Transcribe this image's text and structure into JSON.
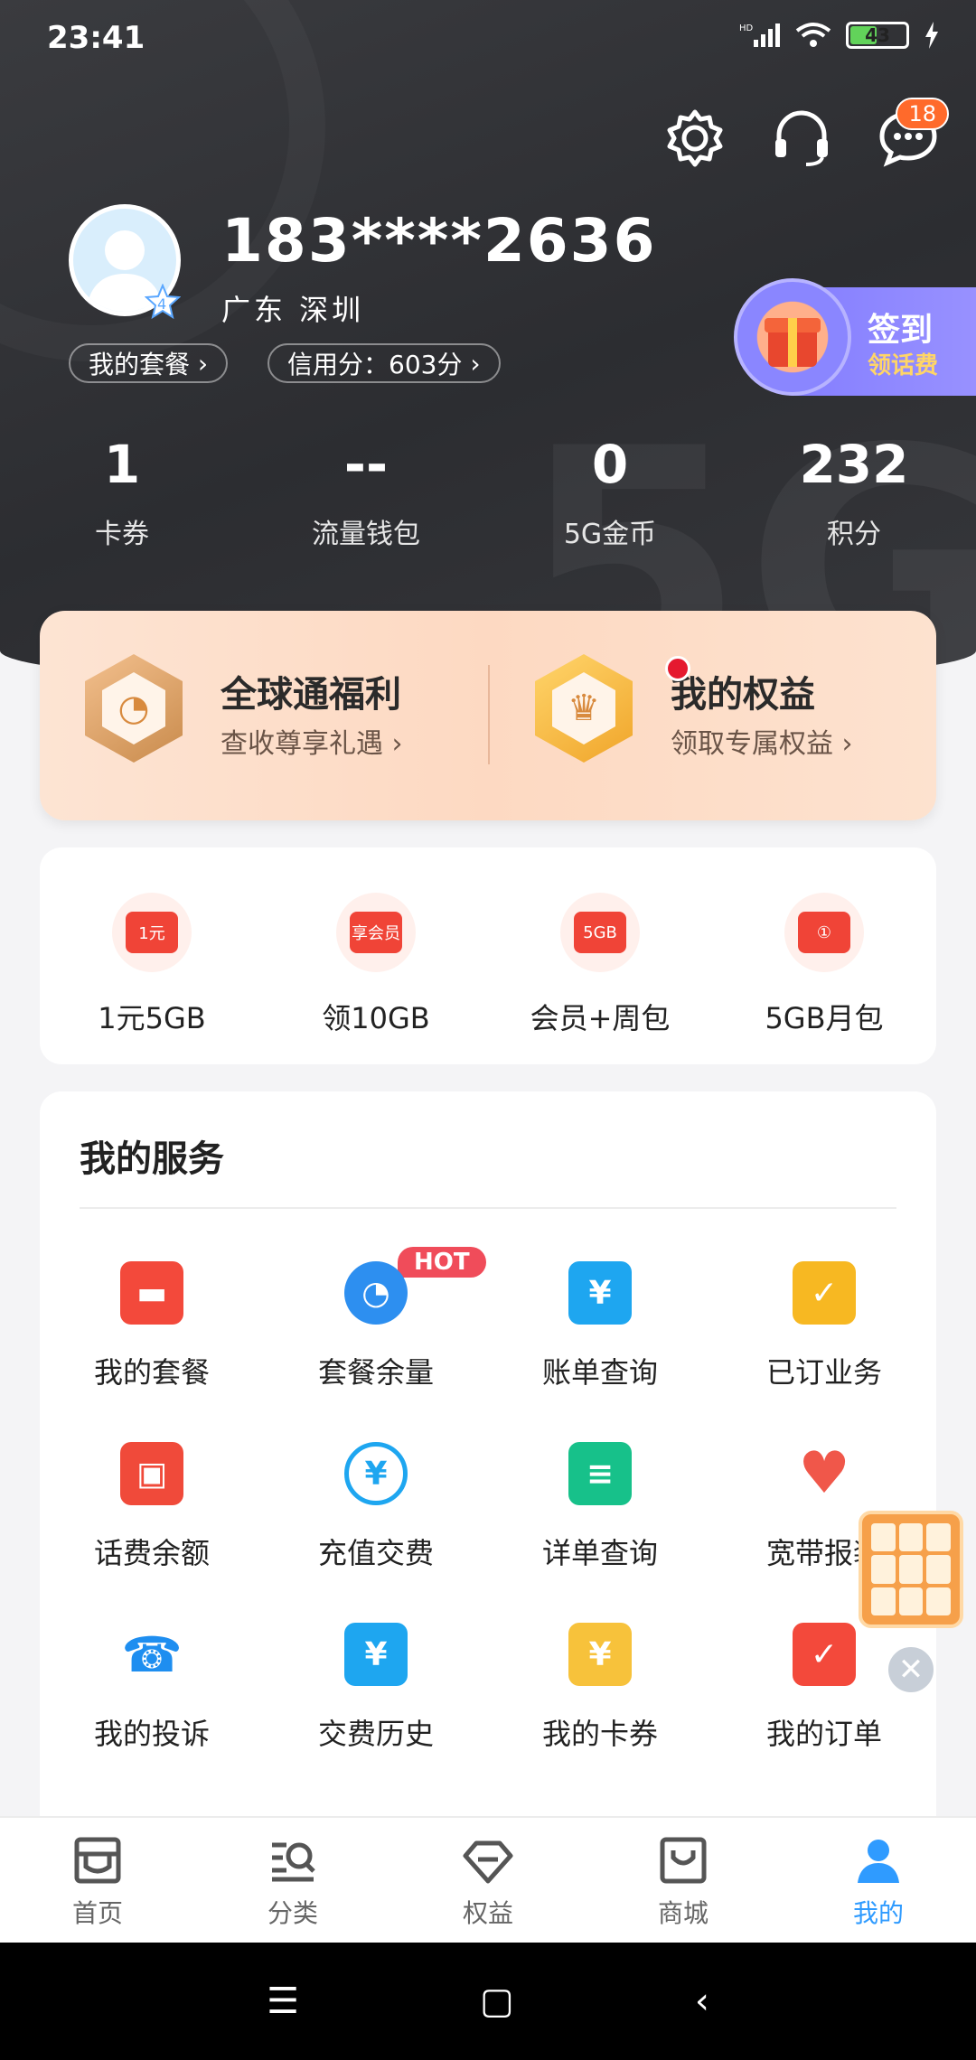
{
  "status_bar": {
    "time": "23:41",
    "network": "HD",
    "battery": "43"
  },
  "header": {
    "message_count": "18",
    "phone": "183****2636",
    "location": "广东  深圳",
    "avatar_level": "4",
    "plan_pill": "我的套餐",
    "credit_pill": "信用分：603分",
    "checkin_title": "签到",
    "checkin_sub": "领话费"
  },
  "stats": [
    {
      "value": "1",
      "label": "卡券"
    },
    {
      "value": "--",
      "label": "流量钱包"
    },
    {
      "value": "0",
      "label": "5G金币"
    },
    {
      "value": "232",
      "label": "积分"
    }
  ],
  "benefits": [
    {
      "title": "全球通福利",
      "sub": "查收尊享礼遇 ›"
    },
    {
      "title": "我的权益",
      "sub": "领取专属权益 ›"
    }
  ],
  "quick": [
    {
      "label": "1元5GB",
      "icon_text": "1元"
    },
    {
      "label": "领10GB",
      "icon_text": "享会员"
    },
    {
      "label": "会员+周包",
      "icon_text": "5GB"
    },
    {
      "label": "5GB月包",
      "icon_text": "①"
    }
  ],
  "services": {
    "title": "我的服务",
    "hot_badge": "HOT",
    "items": [
      {
        "label": "我的套餐",
        "icon": "shopping-bag-icon"
      },
      {
        "label": "套餐余量",
        "icon": "pie-chart-icon"
      },
      {
        "label": "账单查询",
        "icon": "bill-icon"
      },
      {
        "label": "已订业务",
        "icon": "briefcase-icon"
      },
      {
        "label": "话费余额",
        "icon": "wallet-icon"
      },
      {
        "label": "充值交费",
        "icon": "recharge-icon"
      },
      {
        "label": "详单查询",
        "icon": "list-icon"
      },
      {
        "label": "宽带报装",
        "icon": "heart-icon"
      },
      {
        "label": "我的投诉",
        "icon": "phone-alert-icon"
      },
      {
        "label": "交费历史",
        "icon": "receipt-icon"
      },
      {
        "label": "我的卡券",
        "icon": "ticket-icon"
      },
      {
        "label": "我的订单",
        "icon": "clipboard-check-icon"
      }
    ]
  },
  "bottom_nav": [
    {
      "label": "首页",
      "icon": "home-icon"
    },
    {
      "label": "分类",
      "icon": "category-search-icon"
    },
    {
      "label": "权益",
      "icon": "diamond-icon"
    },
    {
      "label": "商城",
      "icon": "shop-bag-icon"
    },
    {
      "label": "我的",
      "icon": "user-icon",
      "active": true
    }
  ],
  "colors": {
    "accent": "#2f9bff",
    "hot": "#f04c5a",
    "header_bg": "#2f3034",
    "checkin": "#8a84ff"
  }
}
